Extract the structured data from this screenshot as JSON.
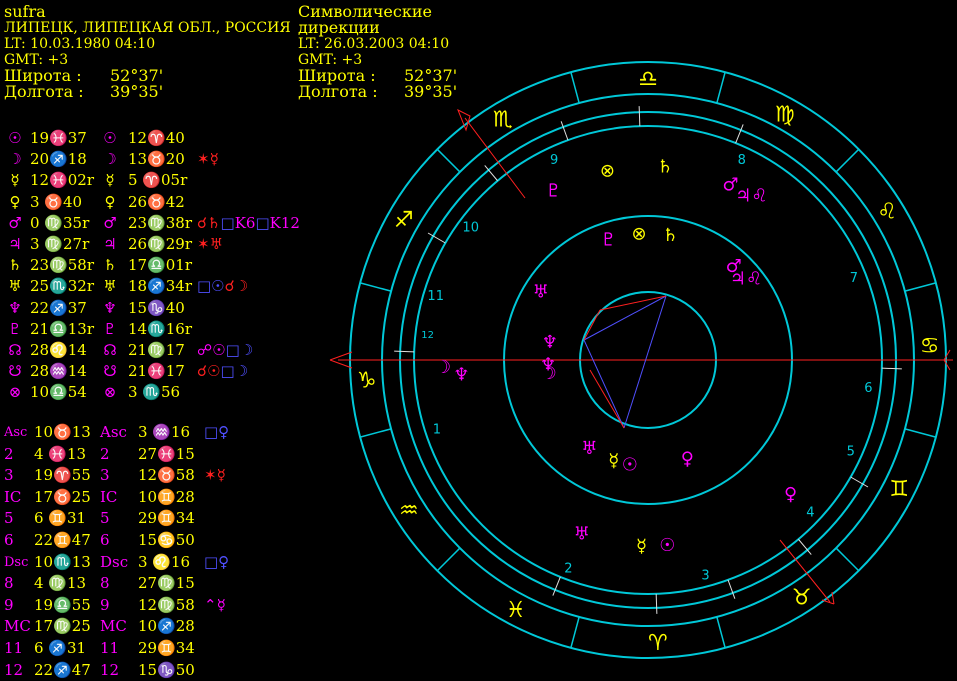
{
  "natal": {
    "name": "sufra",
    "place": "ЛИПЕЦК, ЛИПЕЦКАЯ ОБЛ., РОССИЯ",
    "lt": "LT: 10.03.1980  04:10",
    "gmt": "GMT: +3",
    "lat_label": "Широта :",
    "lat_value": "52°37'",
    "lon_label": "Долгота :",
    "lon_value": "39°35'"
  },
  "directions": {
    "title_line1": "Символические",
    "title_line2": "дирекции",
    "lt": "LT: 26.03.2003  04:10",
    "gmt": "GMT: +3",
    "lat_label": "Широта :",
    "lat_value": "52°37'",
    "lon_label": "Долгота :",
    "lon_value": "39°35'"
  },
  "planets": [
    {
      "glyph": "☉",
      "natal": "19♓37",
      "dir": "12♈40",
      "aspect": [],
      "glyph_color": "#ff00ff"
    },
    {
      "glyph": "☽",
      "natal": "20♐18",
      "dir": "13♉20",
      "aspect": [
        {
          "t": "✶☿",
          "c": "#ff2020"
        }
      ],
      "glyph_color": "#ff00ff"
    },
    {
      "glyph": "☿",
      "natal": "12♓02r",
      "dir": "5 ♈05r",
      "aspect": [],
      "glyph_color": "#ffff00"
    },
    {
      "glyph": "♀",
      "natal": "3 ♉40",
      "dir": "26♉42",
      "aspect": [],
      "glyph_color": "#ffff00"
    },
    {
      "glyph": "♂",
      "natal": "0 ♍35r",
      "dir": "23♍38r",
      "aspect": [
        {
          "t": "☌♄",
          "c": "#ff2020"
        },
        {
          "t": "□",
          "c": "#5050ff"
        },
        {
          "t": "K6",
          "c": "#ff00ff"
        },
        {
          "t": "□",
          "c": "#5050ff"
        },
        {
          "t": "K12",
          "c": "#ff00ff"
        }
      ],
      "glyph_color": "#ff00ff"
    },
    {
      "glyph": "♃",
      "natal": "3 ♍27r",
      "dir": "26♍29r",
      "aspect": [
        {
          "t": "✶♅",
          "c": "#ff2020"
        }
      ],
      "glyph_color": "#ff00ff"
    },
    {
      "glyph": "♄",
      "natal": "23♍58r",
      "dir": "17♎01r",
      "aspect": [],
      "glyph_color": "#ffff00"
    },
    {
      "glyph": "♅",
      "natal": "25♏32r",
      "dir": "18♐34r",
      "aspect": [
        {
          "t": "□☉",
          "c": "#5050ff"
        },
        {
          "t": "☌☽",
          "c": "#ff2020"
        }
      ],
      "glyph_color": "#ffff00"
    },
    {
      "glyph": "♆",
      "natal": "22♐37",
      "dir": "15♑40",
      "aspect": [],
      "glyph_color": "#ff00ff"
    },
    {
      "glyph": "♇",
      "natal": "21♎13r",
      "dir": "14♏16r",
      "aspect": [],
      "glyph_color": "#ff00ff"
    },
    {
      "glyph": "☊",
      "natal": "28♌14",
      "dir": "21♍17",
      "aspect": [
        {
          "t": "☍☉",
          "c": "#ff00ff"
        },
        {
          "t": "□☽",
          "c": "#5050ff"
        }
      ],
      "glyph_color": "#ff00ff"
    },
    {
      "glyph": "☋",
      "natal": "28♒14",
      "dir": "21♓17",
      "aspect": [
        {
          "t": "☌☉",
          "c": "#ff2020"
        },
        {
          "t": "□☽",
          "c": "#5050ff"
        }
      ],
      "glyph_color": "#ff00ff"
    },
    {
      "glyph": "⊗",
      "natal": "10♎54",
      "dir": "3 ♏56",
      "aspect": [],
      "glyph_color": "#ff00ff"
    }
  ],
  "houses": [
    {
      "label": "Asc",
      "natal": "10♉13",
      "dir": "3 ♒16",
      "aspect": [
        {
          "t": "□♀",
          "c": "#5050ff"
        }
      ]
    },
    {
      "label": "2",
      "natal": "4 ♓13",
      "dir": "27♓15",
      "aspect": []
    },
    {
      "label": "3",
      "natal": "19♈55",
      "dir": "12♉58",
      "aspect": [
        {
          "t": "✶☿",
          "c": "#ff2020"
        }
      ]
    },
    {
      "label": "IC",
      "natal": "17♉25",
      "dir": "10♊28",
      "aspect": []
    },
    {
      "label": "5",
      "natal": "6 ♊31",
      "dir": "29♊34",
      "aspect": []
    },
    {
      "label": "6",
      "natal": "22♊47",
      "dir": "15♋50",
      "aspect": []
    },
    {
      "label": "Dsc",
      "natal": "10♏13",
      "dir": "3 ♌16",
      "aspect": [
        {
          "t": "□♀",
          "c": "#5050ff"
        }
      ]
    },
    {
      "label": "8",
      "natal": "4 ♍13",
      "dir": "27♍15",
      "aspect": []
    },
    {
      "label": "9",
      "natal": "19♎55",
      "dir": "12♍58",
      "aspect": [
        {
          "t": "⌃☿",
          "c": "#ff00ff"
        }
      ]
    },
    {
      "label": "MC",
      "natal": "17♍25",
      "dir": "10♐28",
      "aspect": []
    },
    {
      "label": "11",
      "natal": "6 ♐31",
      "dir": "29♊34",
      "aspect": []
    },
    {
      "label": "12",
      "natal": "22♐47",
      "dir": "15♑50",
      "aspect": []
    }
  ],
  "wheel": {
    "signs": [
      {
        "glyph": "♎",
        "angle": 90
      },
      {
        "glyph": "♍",
        "angle": 61
      },
      {
        "glyph": "♌",
        "angle": 32
      },
      {
        "glyph": "♋",
        "angle": 3
      },
      {
        "glyph": "♊",
        "angle": -27
      },
      {
        "glyph": "♉",
        "angle": -57
      },
      {
        "glyph": "♈",
        "angle": -88
      },
      {
        "glyph": "♓",
        "angle": -118
      },
      {
        "glyph": "♒",
        "angle": -148
      },
      {
        "glyph": "♑",
        "angle": -176
      },
      {
        "glyph": "♐",
        "angle": 150
      },
      {
        "glyph": "♏",
        "angle": 121
      }
    ],
    "house_numbers": [
      {
        "n": "1",
        "angle": -162
      },
      {
        "n": "2",
        "angle": -111
      },
      {
        "n": "3",
        "angle": -75
      },
      {
        "n": "4",
        "angle": -43
      },
      {
        "n": "5",
        "angle": -24
      },
      {
        "n": "6",
        "angle": -7
      },
      {
        "n": "7",
        "angle": 22
      },
      {
        "n": "8",
        "angle": 65
      },
      {
        "n": "9",
        "angle": 115
      },
      {
        "n": "10",
        "angle": 143
      },
      {
        "n": "11",
        "angle": 163
      },
      {
        "n": "12",
        "angle": 173
      }
    ],
    "outer_planets": [
      {
        "glyph": "♄",
        "angle": 85,
        "color": "#ffff00"
      },
      {
        "glyph": "♂",
        "angle": 65,
        "color": "#ff00ff"
      },
      {
        "glyph": "♃♌",
        "angle": 58,
        "color": "#ff00ff"
      },
      {
        "glyph": "⊗",
        "angle": 102,
        "color": "#ffff00"
      },
      {
        "glyph": "♇",
        "angle": 119,
        "color": "#ff00ff"
      },
      {
        "glyph": "♀",
        "angle": -43,
        "color": "#ff00ff"
      }
    ],
    "mid_planets": [
      {
        "glyph": "♇",
        "angle": 108,
        "color": "#ff00ff"
      },
      {
        "glyph": "⊗",
        "angle": 94,
        "color": "#ffff00"
      },
      {
        "glyph": "♄",
        "angle": 80,
        "color": "#ffff00"
      },
      {
        "glyph": "♃♌",
        "angle": 40,
        "color": "#ff00ff"
      },
      {
        "glyph": "♂",
        "angle": 48,
        "color": "#ff00ff"
      },
      {
        "glyph": "♅",
        "angle": 147,
        "color": "#ff00ff"
      },
      {
        "glyph": "♆",
        "angle": 169,
        "color": "#ff00ff"
      },
      {
        "glyph": "☽",
        "angle": -173,
        "color": "#ff00ff"
      },
      {
        "glyph": "♆",
        "angle": -178,
        "color": "#ff00ff"
      },
      {
        "glyph": "♅",
        "angle": -124,
        "color": "#ff00ff"
      },
      {
        "glyph": "☿",
        "angle": -109,
        "color": "#ffff00"
      },
      {
        "glyph": "☉",
        "angle": -100,
        "color": "#ff00ff"
      },
      {
        "glyph": "♀",
        "angle": -68,
        "color": "#ff00ff"
      },
      {
        "glyph": "♅",
        "angle": -111,
        "color": "#ff00ff"
      },
      {
        "glyph": "☿",
        "angle": -92,
        "color": "#ffff00"
      },
      {
        "glyph": "☉",
        "angle": -84,
        "color": "#ff00ff"
      }
    ],
    "inner_planets": [
      {
        "glyph": "☽",
        "angle": -178,
        "color": "#ff00ff"
      },
      {
        "glyph": "♆",
        "angle": -176,
        "color": "#ff00ff"
      }
    ]
  }
}
